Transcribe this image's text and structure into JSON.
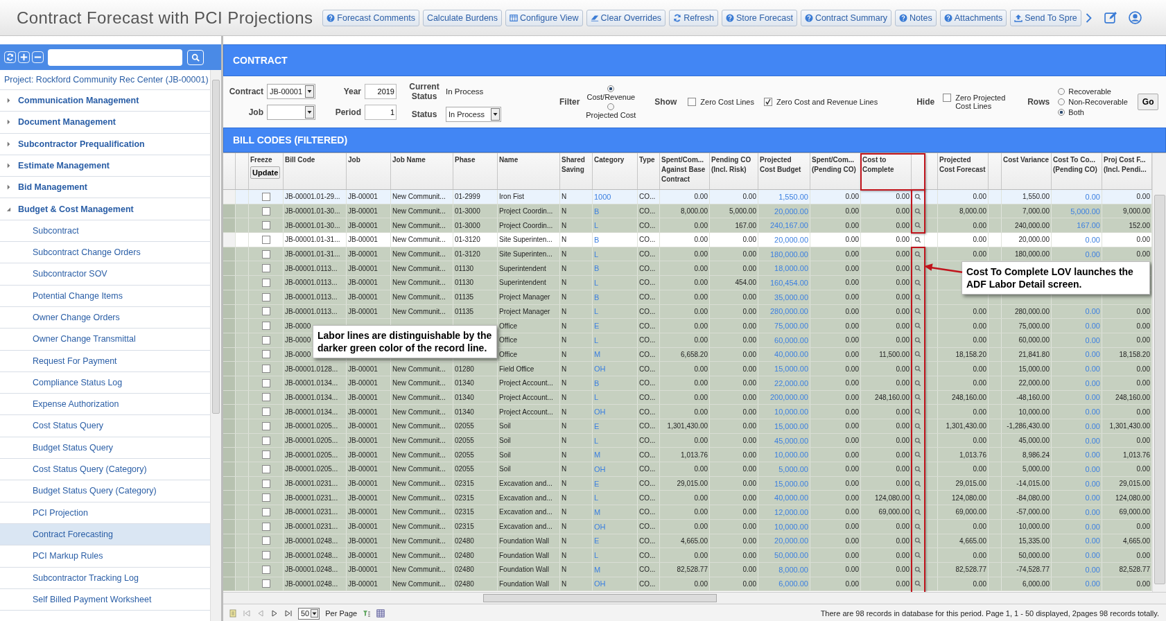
{
  "window": {
    "title": "Contract Forecast with PCI Projections"
  },
  "toolbar": [
    {
      "label": "Forecast Comments",
      "kind": "help"
    },
    {
      "label": "Calculate Burdens",
      "kind": "plain"
    },
    {
      "label": "Configure View",
      "kind": "grid"
    },
    {
      "label": "Clear Overrides",
      "kind": "eraser"
    },
    {
      "label": "Refresh",
      "kind": "refresh"
    },
    {
      "label": "Store Forecast",
      "kind": "help"
    },
    {
      "label": "Contract Summary",
      "kind": "help"
    },
    {
      "label": "Notes",
      "kind": "help"
    },
    {
      "label": "Attachments",
      "kind": "help"
    },
    {
      "label": "Send To Spre",
      "kind": "upload"
    }
  ],
  "sidebar": {
    "project": "Project: Rockford Community Rec Center (JB-00001)",
    "items": [
      {
        "label": "Communication Management",
        "expanded": false
      },
      {
        "label": "Document Management",
        "expanded": false
      },
      {
        "label": "Subcontractor Prequalification",
        "expanded": false
      },
      {
        "label": "Estimate Management",
        "expanded": false
      },
      {
        "label": "Bid Management",
        "expanded": false
      },
      {
        "label": "Budget & Cost Management",
        "expanded": true,
        "children": [
          {
            "label": "Subcontract",
            "selected": false
          },
          {
            "label": "Subcontract Change Orders",
            "selected": false
          },
          {
            "label": "Subcontractor SOV",
            "selected": false
          },
          {
            "label": "Potential Change Items",
            "selected": false
          },
          {
            "label": "Owner Change Orders",
            "selected": false
          },
          {
            "label": "Owner Change Transmittal",
            "selected": false
          },
          {
            "label": "Request For Payment",
            "selected": false
          },
          {
            "label": "Compliance Status Log",
            "selected": false
          },
          {
            "label": "Expense Authorization",
            "selected": false
          },
          {
            "label": "Cost Status Query",
            "selected": false
          },
          {
            "label": "Budget Status Query",
            "selected": false
          },
          {
            "label": "Cost Status Query (Category)",
            "selected": false
          },
          {
            "label": "Budget Status Query (Category)",
            "selected": false
          },
          {
            "label": "PCI Projection",
            "selected": false
          },
          {
            "label": "Contract Forecasting",
            "selected": true
          },
          {
            "label": "PCI Markup Rules",
            "selected": false
          },
          {
            "label": "Subcontractor Tracking Log",
            "selected": false
          },
          {
            "label": "Self Billed Payment Worksheet",
            "selected": false
          }
        ]
      }
    ]
  },
  "contract": {
    "heading": "CONTRACT",
    "contract_label": "Contract",
    "contract_value": "JB-00001",
    "job_label": "Job",
    "year_label": "Year",
    "year_value": "2019",
    "period_label": "Period",
    "period_value": "1",
    "current_status_label": "Current Status",
    "current_status": "In Process",
    "status_label": "Status",
    "status_value": "In Process",
    "filter_label": "Filter",
    "filter_options": [
      {
        "label": "Cost/Revenue",
        "selected": true
      },
      {
        "label": "Projected Cost",
        "selected": false
      }
    ],
    "show_label": "Show",
    "show_options": [
      {
        "label": "Zero Cost Lines",
        "checked": false
      },
      {
        "label": "Zero Cost and Revenue Lines",
        "checked": true
      }
    ],
    "hide_label": "Hide",
    "hide_options": [
      {
        "label": "Zero Projected Cost Lines",
        "checked": false
      }
    ],
    "rows_label": "Rows",
    "rows_options": [
      {
        "label": "Recoverable",
        "selected": false
      },
      {
        "label": "Non-Recoverable",
        "selected": false
      },
      {
        "label": "Both",
        "selected": true
      }
    ],
    "go": "Go"
  },
  "bill_codes": {
    "heading": "BILL CODES (FILTERED)",
    "freeze": {
      "label": "Freeze",
      "button": "Update"
    },
    "columns": [
      {
        "kind": "text",
        "label": "Bill Code"
      },
      {
        "kind": "text",
        "label": "Job"
      },
      {
        "kind": "text",
        "label": "Job Name"
      },
      {
        "kind": "text",
        "label": "Phase"
      },
      {
        "kind": "text",
        "label": "Name"
      },
      {
        "kind": "text",
        "label": "Shared Saving"
      },
      {
        "kind": "link",
        "label": "Category"
      },
      {
        "kind": "text",
        "label": "Type"
      },
      {
        "kind": "num",
        "label": "Spent/Com... Against Base Contract"
      },
      {
        "kind": "num",
        "label": "Pending CO (Incl. Risk)"
      },
      {
        "kind": "numlink",
        "label": "Projected Cost Budget"
      },
      {
        "kind": "num",
        "label": "Spent/Com... (Pending CO)"
      },
      {
        "kind": "numlov",
        "label": "Cost to Complete"
      },
      {
        "kind": "numgap",
        "label": "Projected Cost Forecast"
      },
      {
        "kind": "num",
        "label": "Cost Variance"
      },
      {
        "kind": "numlink",
        "label": "Cost To Co... (Pending CO)"
      },
      {
        "kind": "num",
        "label": "Proj Cost F... (Incl. Pendi..."
      }
    ],
    "rows": [
      {
        "selected": true,
        "labor": false,
        "checked": false,
        "cells": [
          "JB-00001.01-29...",
          "JB-00001",
          "New Communit...",
          "01-2999",
          "Iron Fist",
          "N",
          "1000",
          "CO...",
          "0.00",
          "0.00",
          "1,550.00",
          "0.00",
          "0.00",
          "0.00",
          "1,550.00",
          "0.00",
          "0.00"
        ]
      },
      {
        "selected": false,
        "labor": true,
        "checked": false,
        "cells": [
          "JB-00001.01-30...",
          "JB-00001",
          "New Communit...",
          "01-3000",
          "Project Coordin...",
          "N",
          "B",
          "CO...",
          "8,000.00",
          "5,000.00",
          "20,000.00",
          "0.00",
          "0.00",
          "8,000.00",
          "7,000.00",
          "5,000.00",
          "9,000.00"
        ]
      },
      {
        "selected": false,
        "labor": true,
        "checked": false,
        "cells": [
          "JB-00001.01-30...",
          "JB-00001",
          "New Communit...",
          "01-3000",
          "Project Coordin...",
          "N",
          "L",
          "CO...",
          "0.00",
          "167.00",
          "240,167.00",
          "0.00",
          "0.00",
          "0.00",
          "240,000.00",
          "167.00",
          "152.00"
        ]
      },
      {
        "selected": false,
        "labor": false,
        "checked": false,
        "cells": [
          "JB-00001.01-31...",
          "JB-00001",
          "New Communit...",
          "01-3120",
          "Site Superinten...",
          "N",
          "B",
          "CO...",
          "0.00",
          "0.00",
          "20,000.00",
          "0.00",
          "0.00",
          "0.00",
          "20,000.00",
          "0.00",
          "0.00"
        ]
      },
      {
        "selected": false,
        "labor": true,
        "checked": false,
        "cells": [
          "JB-00001.01-31...",
          "JB-00001",
          "New Communit...",
          "01-3120",
          "Site Superinten...",
          "N",
          "L",
          "CO...",
          "0.00",
          "0.00",
          "180,000.00",
          "0.00",
          "0.00",
          "0.00",
          "180,000.00",
          "0.00",
          "0.00"
        ]
      },
      {
        "selected": false,
        "labor": true,
        "checked": false,
        "cells": [
          "JB-00001.0113...",
          "JB-00001",
          "New Communit...",
          "01130",
          "Superintendent",
          "N",
          "B",
          "CO...",
          "0.00",
          "0.00",
          "18,000.00",
          "0.00",
          "0.00",
          null,
          null,
          null,
          null
        ]
      },
      {
        "selected": false,
        "labor": true,
        "checked": false,
        "cells": [
          "JB-00001.0113...",
          "JB-00001",
          "New Communit...",
          "01130",
          "Superintendent",
          "N",
          "L",
          "CO...",
          "0.00",
          "454.00",
          "160,454.00",
          "0.00",
          "0.00",
          null,
          null,
          null,
          null
        ]
      },
      {
        "selected": false,
        "labor": true,
        "checked": false,
        "cells": [
          "JB-00001.0113...",
          "JB-00001",
          "New Communit...",
          "01135",
          "Project Manager",
          "N",
          "B",
          "CO...",
          "0.00",
          "0.00",
          "35,000.00",
          "0.00",
          "0.00",
          null,
          null,
          null,
          null
        ]
      },
      {
        "selected": false,
        "labor": true,
        "checked": false,
        "cells": [
          "JB-00001.0113...",
          "JB-00001",
          "New Communit...",
          "01135",
          "Project Manager",
          "N",
          "L",
          "CO...",
          "0.00",
          "0.00",
          "280,000.00",
          "0.00",
          "0.00",
          "0.00",
          "280,000.00",
          "0.00",
          "0.00"
        ]
      },
      {
        "selected": false,
        "labor": true,
        "checked": false,
        "cells": [
          "JB-0000",
          null,
          null,
          null,
          "Office",
          "N",
          "E",
          "CO...",
          "0.00",
          "0.00",
          "75,000.00",
          "0.00",
          "0.00",
          "0.00",
          "75,000.00",
          "0.00",
          "0.00"
        ]
      },
      {
        "selected": false,
        "labor": true,
        "checked": false,
        "cells": [
          "JB-0000",
          null,
          null,
          null,
          "Office",
          "N",
          "L",
          "CO...",
          "0.00",
          "0.00",
          "60,000.00",
          "0.00",
          "0.00",
          "0.00",
          "60,000.00",
          "0.00",
          "0.00"
        ]
      },
      {
        "selected": false,
        "labor": true,
        "checked": false,
        "cells": [
          "JB-0000",
          null,
          null,
          null,
          "Office",
          "N",
          "M",
          "CO...",
          "6,658.20",
          "0.00",
          "40,000.00",
          "0.00",
          "11,500.00",
          "18,158.20",
          "21,841.80",
          "0.00",
          "18,158.20"
        ]
      },
      {
        "selected": false,
        "labor": true,
        "checked": false,
        "cells": [
          "JB-00001.0128...",
          "JB-00001",
          "New Communit...",
          "01280",
          "Field Office",
          "N",
          "OH",
          "CO...",
          "0.00",
          "0.00",
          "15,000.00",
          "0.00",
          "0.00",
          "0.00",
          "15,000.00",
          "0.00",
          "0.00"
        ]
      },
      {
        "selected": false,
        "labor": true,
        "checked": false,
        "cells": [
          "JB-00001.0134...",
          "JB-00001",
          "New Communit...",
          "01340",
          "Project Account...",
          "N",
          "B",
          "CO...",
          "0.00",
          "0.00",
          "22,000.00",
          "0.00",
          "0.00",
          "0.00",
          "22,000.00",
          "0.00",
          "0.00"
        ]
      },
      {
        "selected": false,
        "labor": true,
        "checked": false,
        "cells": [
          "JB-00001.0134...",
          "JB-00001",
          "New Communit...",
          "01340",
          "Project Account...",
          "N",
          "L",
          "CO...",
          "0.00",
          "0.00",
          "200,000.00",
          "0.00",
          "248,160.00",
          "248,160.00",
          "-48,160.00",
          "0.00",
          "248,160.00"
        ]
      },
      {
        "selected": false,
        "labor": true,
        "checked": false,
        "cells": [
          "JB-00001.0134...",
          "JB-00001",
          "New Communit...",
          "01340",
          "Project Account...",
          "N",
          "OH",
          "CO...",
          "0.00",
          "0.00",
          "10,000.00",
          "0.00",
          "0.00",
          "0.00",
          "10,000.00",
          "0.00",
          "0.00"
        ]
      },
      {
        "selected": false,
        "labor": true,
        "checked": false,
        "cells": [
          "JB-00001.0205...",
          "JB-00001",
          "New Communit...",
          "02055",
          "Soil",
          "N",
          "E",
          "CO...",
          "1,301,430.00",
          "0.00",
          "15,000.00",
          "0.00",
          "0.00",
          "1,301,430.00",
          "-1,286,430.00",
          "0.00",
          "1,301,430.00"
        ]
      },
      {
        "selected": false,
        "labor": true,
        "checked": false,
        "cells": [
          "JB-00001.0205...",
          "JB-00001",
          "New Communit...",
          "02055",
          "Soil",
          "N",
          "L",
          "CO...",
          "0.00",
          "0.00",
          "45,000.00",
          "0.00",
          "0.00",
          "0.00",
          "45,000.00",
          "0.00",
          "0.00"
        ]
      },
      {
        "selected": false,
        "labor": true,
        "checked": false,
        "cells": [
          "JB-00001.0205...",
          "JB-00001",
          "New Communit...",
          "02055",
          "Soil",
          "N",
          "M",
          "CO...",
          "1,013.76",
          "0.00",
          "10,000.00",
          "0.00",
          "0.00",
          "1,013.76",
          "8,986.24",
          "0.00",
          "1,013.76"
        ]
      },
      {
        "selected": false,
        "labor": true,
        "checked": false,
        "cells": [
          "JB-00001.0205...",
          "JB-00001",
          "New Communit...",
          "02055",
          "Soil",
          "N",
          "OH",
          "CO...",
          "0.00",
          "0.00",
          "5,000.00",
          "0.00",
          "0.00",
          "0.00",
          "5,000.00",
          "0.00",
          "0.00"
        ]
      },
      {
        "selected": false,
        "labor": true,
        "checked": false,
        "cells": [
          "JB-00001.0231...",
          "JB-00001",
          "New Communit...",
          "02315",
          "Excavation and...",
          "N",
          "E",
          "CO...",
          "29,015.00",
          "0.00",
          "15,000.00",
          "0.00",
          "0.00",
          "29,015.00",
          "-14,015.00",
          "0.00",
          "29,015.00"
        ]
      },
      {
        "selected": false,
        "labor": true,
        "checked": false,
        "cells": [
          "JB-00001.0231...",
          "JB-00001",
          "New Communit...",
          "02315",
          "Excavation and...",
          "N",
          "L",
          "CO...",
          "0.00",
          "0.00",
          "40,000.00",
          "0.00",
          "124,080.00",
          "124,080.00",
          "-84,080.00",
          "0.00",
          "124,080.00"
        ]
      },
      {
        "selected": false,
        "labor": true,
        "checked": false,
        "cells": [
          "JB-00001.0231...",
          "JB-00001",
          "New Communit...",
          "02315",
          "Excavation and...",
          "N",
          "M",
          "CO...",
          "0.00",
          "0.00",
          "12,000.00",
          "0.00",
          "69,000.00",
          "69,000.00",
          "-57,000.00",
          "0.00",
          "69,000.00"
        ]
      },
      {
        "selected": false,
        "labor": true,
        "checked": false,
        "cells": [
          "JB-00001.0231...",
          "JB-00001",
          "New Communit...",
          "02315",
          "Excavation and...",
          "N",
          "OH",
          "CO...",
          "0.00",
          "0.00",
          "10,000.00",
          "0.00",
          "0.00",
          "0.00",
          "10,000.00",
          "0.00",
          "0.00"
        ]
      },
      {
        "selected": false,
        "labor": true,
        "checked": false,
        "cells": [
          "JB-00001.0248...",
          "JB-00001",
          "New Communit...",
          "02480",
          "Foundation Wall",
          "N",
          "E",
          "CO...",
          "4,665.00",
          "0.00",
          "20,000.00",
          "0.00",
          "0.00",
          "4,665.00",
          "15,335.00",
          "0.00",
          "4,665.00"
        ]
      },
      {
        "selected": false,
        "labor": true,
        "checked": false,
        "cells": [
          "JB-00001.0248...",
          "JB-00001",
          "New Communit...",
          "02480",
          "Foundation Wall",
          "N",
          "L",
          "CO...",
          "0.00",
          "0.00",
          "50,000.00",
          "0.00",
          "0.00",
          "0.00",
          "50,000.00",
          "0.00",
          "0.00"
        ]
      },
      {
        "selected": false,
        "labor": true,
        "checked": false,
        "cells": [
          "JB-00001.0248...",
          "JB-00001",
          "New Communit...",
          "02480",
          "Foundation Wall",
          "N",
          "M",
          "CO...",
          "82,528.77",
          "0.00",
          "8,000.00",
          "0.00",
          "0.00",
          "82,528.77",
          "-74,528.77",
          "0.00",
          "82,528.77"
        ]
      },
      {
        "selected": false,
        "labor": true,
        "checked": false,
        "cells": [
          "JB-00001.0248...",
          "JB-00001",
          "New Communit...",
          "02480",
          "Foundation Wall",
          "N",
          "OH",
          "CO...",
          "0.00",
          "0.00",
          "6,000.00",
          "0.00",
          "0.00",
          "0.00",
          "6,000.00",
          "0.00",
          "0.00"
        ]
      }
    ],
    "callouts": [
      "Labor lines are distinguishable by the darker green color of the record line.",
      "Cost To Complete LOV launches the ADF Labor Detail screen."
    ]
  },
  "footer": {
    "page_size": "50",
    "per_page": "Per Page",
    "status": "There are 98 records in database for this period.  Page 1, 1 - 50 displayed, 2pages 98 records totally."
  }
}
